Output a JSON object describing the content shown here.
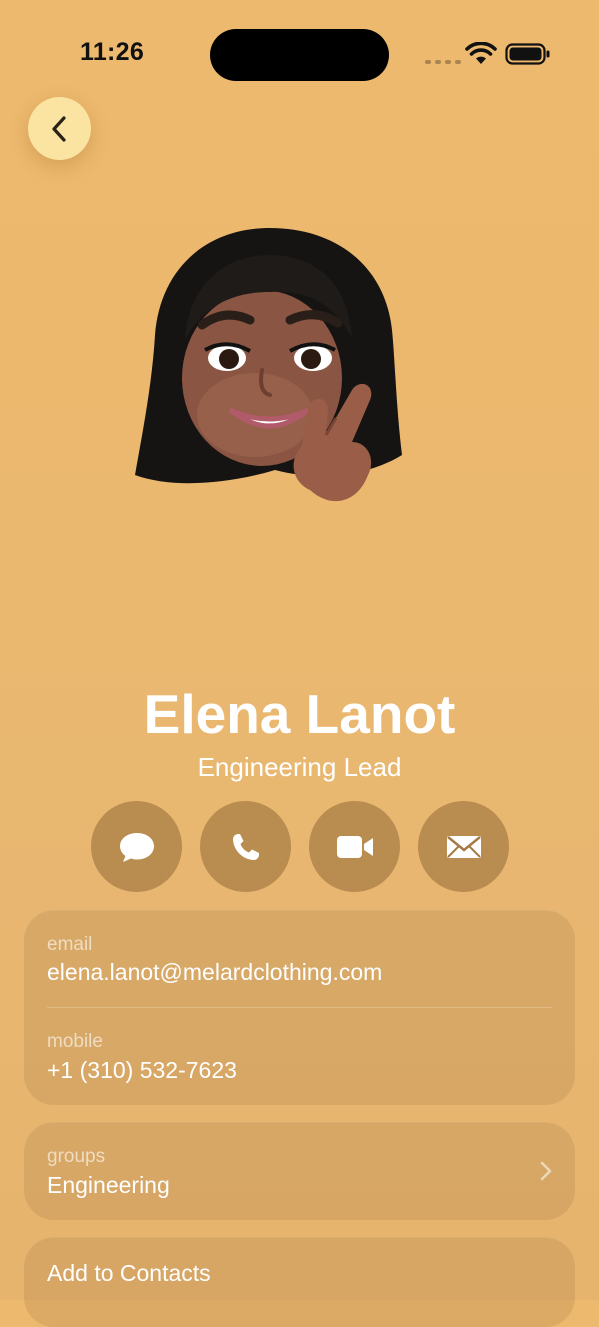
{
  "status_bar": {
    "time": "11:26"
  },
  "header": {
    "back_icon": "chevron-left-icon"
  },
  "contact": {
    "name": "Elena Lanot",
    "subtitle": "Engineering Lead",
    "avatar": "memoji-avatar"
  },
  "actions": [
    {
      "icon": "message-icon"
    },
    {
      "icon": "phone-icon"
    },
    {
      "icon": "video-icon"
    },
    {
      "icon": "mail-icon"
    }
  ],
  "info": {
    "email_label": "email",
    "email_value": "elena.lanot@melardclothing.com",
    "mobile_label": "mobile",
    "mobile_value": "+1 (310) 532-7623"
  },
  "groups": {
    "label": "groups",
    "value": "Engineering"
  },
  "add_to_contacts": "Add to Contacts",
  "colors": {
    "background": "#EBB86F",
    "back_button": "#FBE3A1",
    "action_button": "#A57A45"
  }
}
